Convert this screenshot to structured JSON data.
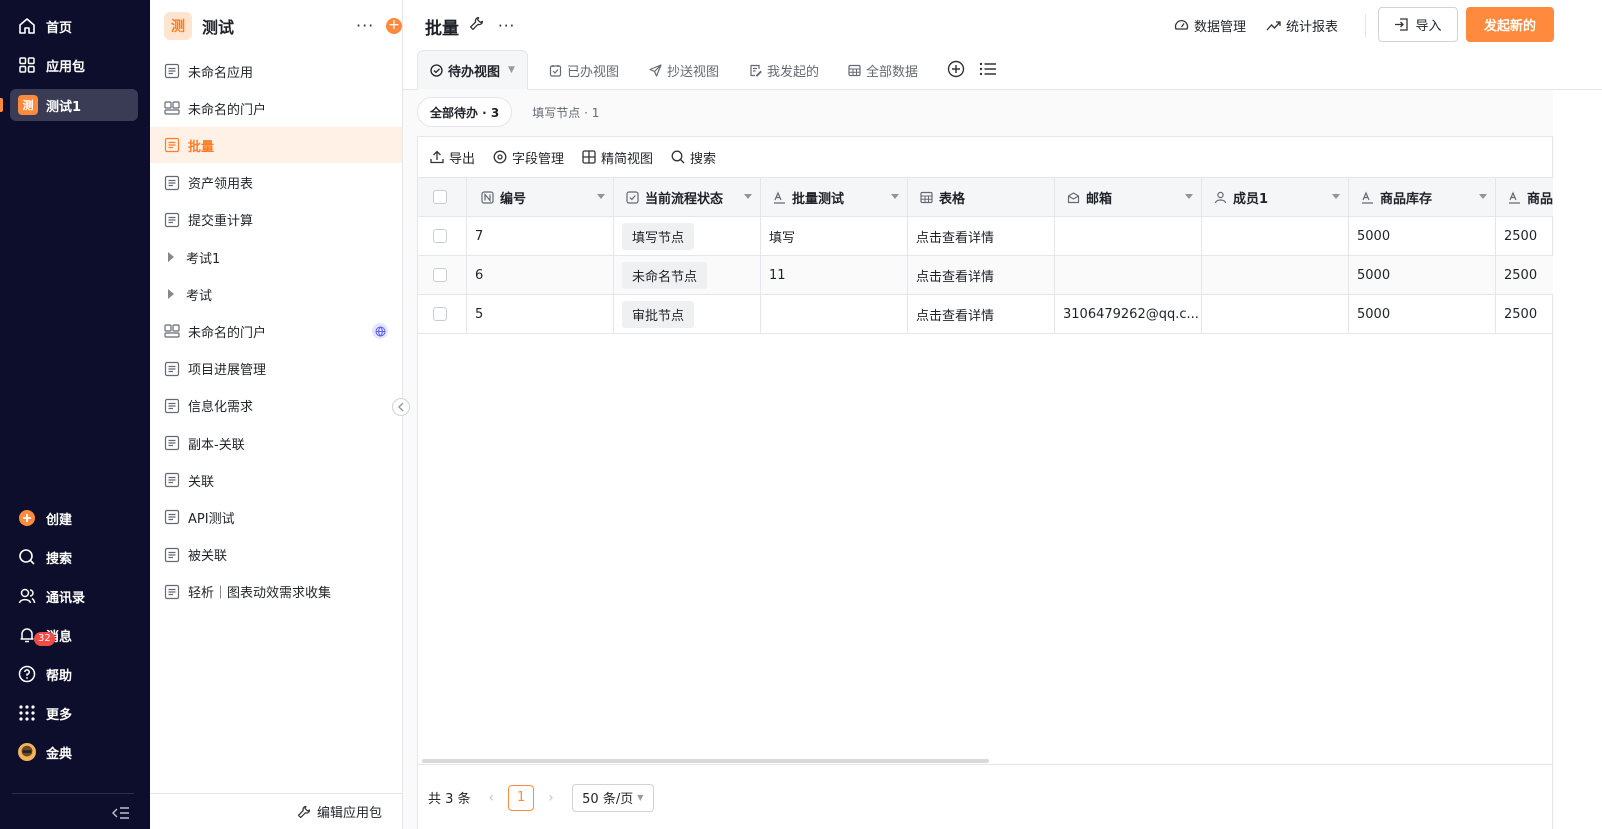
{
  "nav": {
    "items": [
      {
        "label": "首页",
        "icon": "home-icon"
      },
      {
        "label": "应用包",
        "icon": "grid-icon"
      },
      {
        "label": "测试1",
        "icon": "app-badge",
        "badge_char": "测"
      }
    ],
    "bottom": [
      {
        "label": "创建",
        "icon": "plus-circle-icon"
      },
      {
        "label": "搜索",
        "icon": "search-icon"
      },
      {
        "label": "通讯录",
        "icon": "contacts-icon"
      },
      {
        "label": "消息",
        "icon": "bell-icon",
        "count": "32"
      },
      {
        "label": "帮助",
        "icon": "help-icon"
      },
      {
        "label": "更多",
        "icon": "dots-grid-icon"
      },
      {
        "label": "金典",
        "icon": "avatar"
      }
    ],
    "accent_color": "#ff8a3d"
  },
  "sidebar": {
    "logo_char": "测",
    "title": "测试",
    "items": [
      {
        "label": "未命名应用",
        "icon": "form-icon"
      },
      {
        "label": "未命名的门户",
        "icon": "portal-icon"
      },
      {
        "label": "批量",
        "icon": "form-icon",
        "active": true
      },
      {
        "label": "资产领用表",
        "icon": "form-icon"
      },
      {
        "label": "提交重计算",
        "icon": "form-icon"
      },
      {
        "label": "考试1",
        "icon": "caret-right-icon"
      },
      {
        "label": "考试",
        "icon": "caret-right-icon"
      },
      {
        "label": "未命名的门户",
        "icon": "portal-icon",
        "globe": true
      },
      {
        "label": "项目进展管理",
        "icon": "form-icon"
      },
      {
        "label": "信息化需求",
        "icon": "form-icon"
      },
      {
        "label": "副本-关联",
        "icon": "form-icon"
      },
      {
        "label": "关联",
        "icon": "form-icon"
      },
      {
        "label": "API测试",
        "icon": "form-icon"
      },
      {
        "label": "被关联",
        "icon": "form-icon"
      },
      {
        "label": "轻析｜图表动效需求收集",
        "icon": "form-icon"
      }
    ],
    "footer_label": "编辑应用包"
  },
  "header": {
    "title": "批量",
    "data_manage": "数据管理",
    "stats_report": "统计报表",
    "import_label": "导入",
    "launch_label": "发起新的"
  },
  "tabs": [
    {
      "label": "待办视图",
      "icon": "check-circle-icon",
      "active": true
    },
    {
      "label": "已办视图",
      "icon": "calendar-check-icon"
    },
    {
      "label": "抄送视图",
      "icon": "send-icon"
    },
    {
      "label": "我发起的",
      "icon": "doc-edit-icon"
    },
    {
      "label": "全部数据",
      "icon": "table-icon"
    }
  ],
  "filters": {
    "all_pending": "全部待办 · 3",
    "fill_node": "填写节点 · 1"
  },
  "toolbar": {
    "export": "导出",
    "field_manage": "字段管理",
    "simple_view": "精简视图",
    "search": "搜索"
  },
  "table": {
    "columns": [
      {
        "label": "编号",
        "icon": "number-icon"
      },
      {
        "label": "当前流程状态",
        "icon": "checkbox-icon"
      },
      {
        "label": "批量测试",
        "icon": "text-icon"
      },
      {
        "label": "表格",
        "icon": "table-icon"
      },
      {
        "label": "邮箱",
        "icon": "mail-icon"
      },
      {
        "label": "成员1",
        "icon": "user-icon"
      },
      {
        "label": "商品库存",
        "icon": "text-icon"
      },
      {
        "label": "商品",
        "icon": "text-icon"
      }
    ],
    "rows": [
      {
        "id": "7",
        "status": "填写节点",
        "batch": "填写",
        "table": "点击查看详情",
        "email": "",
        "member": "",
        "stock": "5000",
        "goods": "2500"
      },
      {
        "id": "6",
        "status": "未命名节点",
        "batch": "11",
        "table": "点击查看详情",
        "email": "",
        "member": "",
        "stock": "5000",
        "goods": "2500"
      },
      {
        "id": "5",
        "status": "审批节点",
        "batch": "",
        "table": "点击查看详情",
        "email": "3106479262@qq.c...",
        "member": "",
        "stock": "5000",
        "goods": "2500"
      }
    ]
  },
  "pager": {
    "total": "共 3 条",
    "current": "1",
    "page_size": "50 条/页"
  }
}
